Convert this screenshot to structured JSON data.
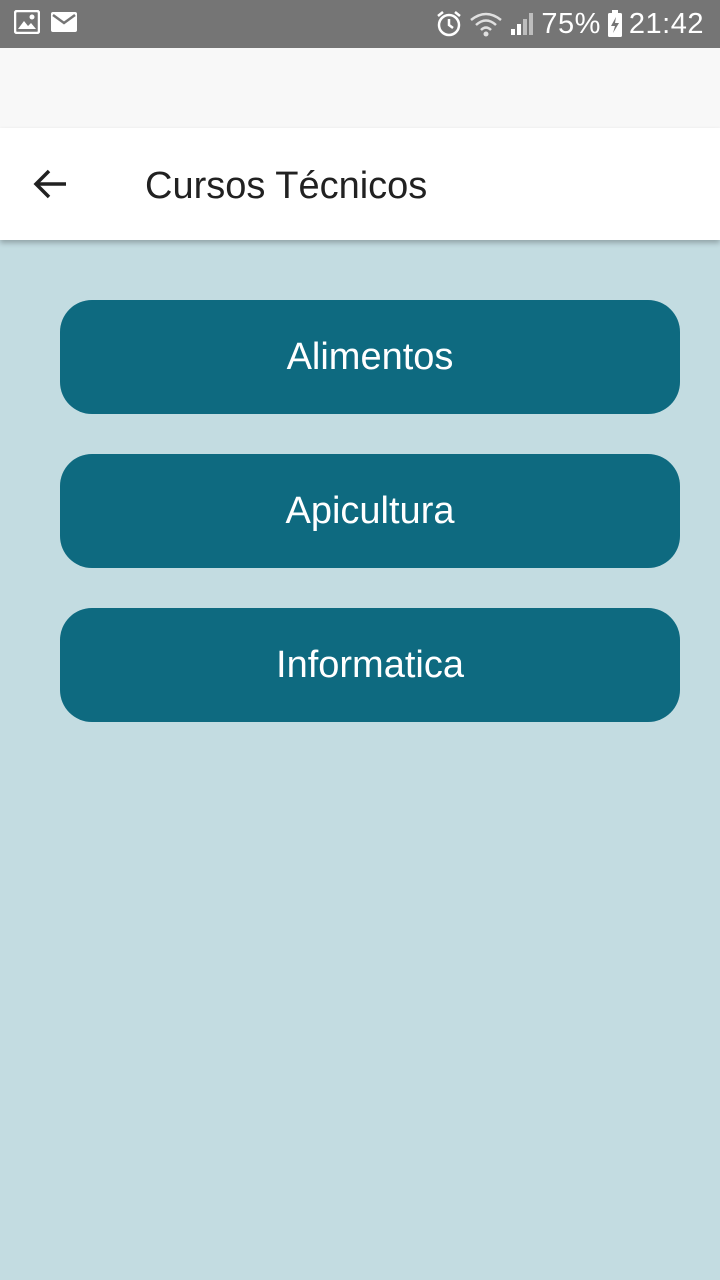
{
  "status_bar": {
    "left_icons": [
      "gallery-icon",
      "mail-icon"
    ],
    "right_icons": [
      "alarm-icon",
      "wifi-icon",
      "signal-icon",
      "battery-charging-icon"
    ],
    "battery_percent": "75%",
    "time": "21:42",
    "background_color": "#757575"
  },
  "app_bar": {
    "back_icon": "arrow-back-icon",
    "title": "Cursos Técnicos"
  },
  "courses": [
    {
      "label": "Alimentos"
    },
    {
      "label": "Apicultura"
    },
    {
      "label": "Informatica"
    }
  ],
  "colors": {
    "content_background": "#c3dce1",
    "button_background": "#0e6a80",
    "button_text": "#ffffff",
    "title_text": "#212121"
  }
}
